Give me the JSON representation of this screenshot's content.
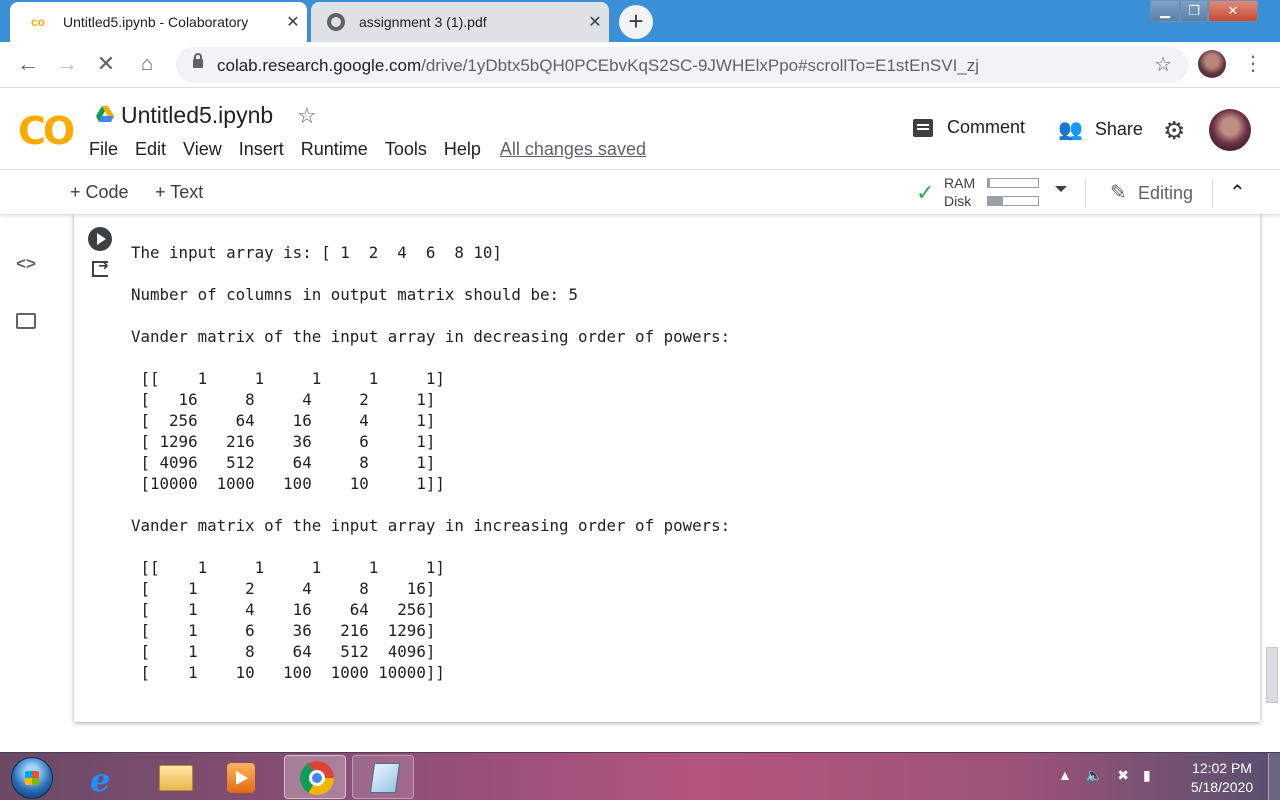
{
  "browser": {
    "tabs": [
      {
        "title": "Untitled5.ipynb - Colaboratory",
        "favicon": "colab-icon",
        "active": true
      },
      {
        "title": "assignment 3 (1).pdf",
        "favicon": "globe-icon",
        "active": false
      }
    ],
    "url_main": "colab.research.google.com",
    "url_rest": "/drive/1yDbtx5bQH0PCEbvKqS2SC-9JWHElxPpo#scrollTo=E1stEnSVI_zj",
    "newtab_label": "+",
    "close_glyph": "✕"
  },
  "colab": {
    "logo": "CO",
    "notebook_title": "Untitled5.ipynb",
    "menu": [
      "File",
      "Edit",
      "View",
      "Insert",
      "Runtime",
      "Tools",
      "Help"
    ],
    "save_status": "All changes saved",
    "comment_label": "Comment",
    "share_label": "Share"
  },
  "toolbar": {
    "add_code": "+ Code",
    "add_text": "+ Text",
    "ram_label": "RAM",
    "disk_label": "Disk",
    "ram_usage": 0.04,
    "disk_usage": 0.3,
    "editing_label": "Editing"
  },
  "output": {
    "dashes": "-------------------------------------------------------------",
    "lines": [
      "The input array is: [ 1  2  4  6  8 10]",
      "",
      "Number of columns in output matrix should be: 5",
      "",
      "Vander matrix of the input array in decreasing order of powers:",
      "",
      " [[    1     1     1     1     1]",
      " [   16     8     4     2     1]",
      " [  256    64    16     4     1]",
      " [ 1296   216    36     6     1]",
      " [ 4096   512    64     8     1]",
      " [10000  1000   100    10     1]]",
      "",
      "Vander matrix of the input array in increasing order of powers:",
      "",
      " [[    1     1     1     1     1]",
      " [    1     2     4     8    16]",
      " [    1     4    16    64   256]",
      " [    1     6    36   216  1296]",
      " [    1     8    64   512  4096]",
      " [    1    10   100  1000 10000]]"
    ]
  },
  "taskbar": {
    "clock_time": "12:02 PM",
    "clock_date": "5/18/2020"
  },
  "colors": {
    "colab_orange": "#f9ab00",
    "check_green": "#34a853",
    "tab_strip_blue": "#3a8fd6"
  }
}
